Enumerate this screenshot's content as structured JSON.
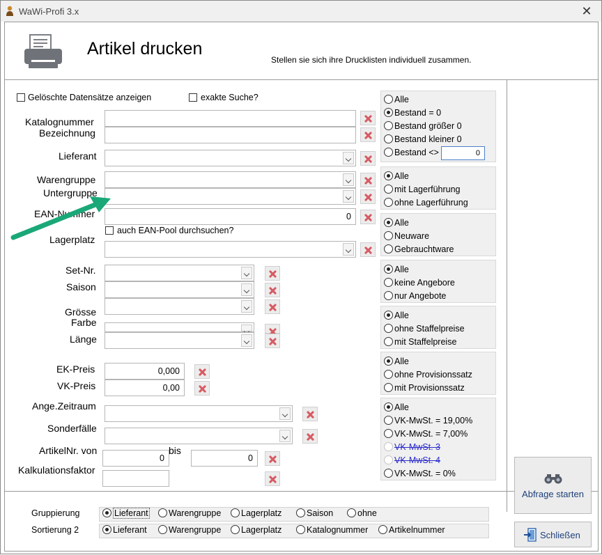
{
  "window": {
    "title": "WaWi-Profi 3.x",
    "close": "✕"
  },
  "header": {
    "title": "Artikel drucken",
    "subtitle": "Stellen sie sich ihre Drucklisten individuell zusammen."
  },
  "filters": {
    "show_deleted": "Gelöschte Datensätze anzeigen",
    "exact_search": "exakte Suche?",
    "katalognummer": "Katalognummer",
    "bezeichnung": "Bezeichnung",
    "lieferant": "Lieferant",
    "warengruppe": "Warengruppe",
    "untergruppe": "Untergruppe",
    "ean_nummer": "EAN-Nummer",
    "ean_value": "0",
    "ean_pool": "auch EAN-Pool durchsuchen?",
    "lagerplatz": "Lagerplatz",
    "set_nr": "Set-Nr.",
    "saison": "Saison",
    "groesse": "Grösse",
    "farbe": "Farbe",
    "laenge": "Länge",
    "ek_preis": "EK-Preis",
    "ek_value": "0,000",
    "vk_preis": "VK-Preis",
    "vk_value": "0,00",
    "ange_zeitraum": "Ange.Zeitraum",
    "sonderfaelle": "Sonderfälle",
    "artikelnr_von": "ArtikelNr. von",
    "artikelnr_von_value": "0",
    "bis": "bis",
    "artikelnr_bis_value": "0",
    "kalkulationsfaktor": "Kalkulationsfaktor"
  },
  "options": {
    "bestand": {
      "alle": "Alle",
      "gleich0": "Bestand = 0",
      "groesser0": "Bestand größer 0",
      "kleiner0": "Bestand kleiner 0",
      "ungleich": "Bestand <>",
      "ungleich_value": "0"
    },
    "lager": {
      "alle": "Alle",
      "mit": "mit Lagerführung",
      "ohne": "ohne Lagerführung"
    },
    "zustand": {
      "alle": "Alle",
      "neu": "Neuware",
      "gebraucht": "Gebrauchtware"
    },
    "angebote": {
      "alle": "Alle",
      "keine": "keine Angebore",
      "nur": "nur Angebote"
    },
    "staffel": {
      "alle": "Alle",
      "ohne": "ohne Staffelpreise",
      "mit": "mit Staffelpreise"
    },
    "provision": {
      "alle": "Alle",
      "ohne": "ohne Provisionssatz",
      "mit": "mit Provisionssatz"
    },
    "mwst": {
      "alle": "Alle",
      "v19": "VK-MwSt. = 19,00%",
      "v7": "VK-MwSt. =  7,00%",
      "v3": "VK-MwSt. 3",
      "v4": "VK-MwSt. 4",
      "v0": "VK-MwSt. = 0%"
    }
  },
  "buttons": {
    "abfrage": "Abfrage starten",
    "schliessen": "Schließen"
  },
  "gruppierung": {
    "label": "Gruppierung",
    "options": [
      "Lieferant",
      "Warengruppe",
      "Lagerplatz",
      "Saison",
      "ohne"
    ]
  },
  "sortierung": {
    "label": "Sortierung 2",
    "options": [
      "Lieferant",
      "Warengruppe",
      "Lagerplatz",
      "Katalognummer",
      "Artikelnummer"
    ]
  },
  "colors": {
    "accent_arrow": "#1aa878",
    "clear_x": "#d75b63",
    "button_text": "#1d3f7a"
  }
}
